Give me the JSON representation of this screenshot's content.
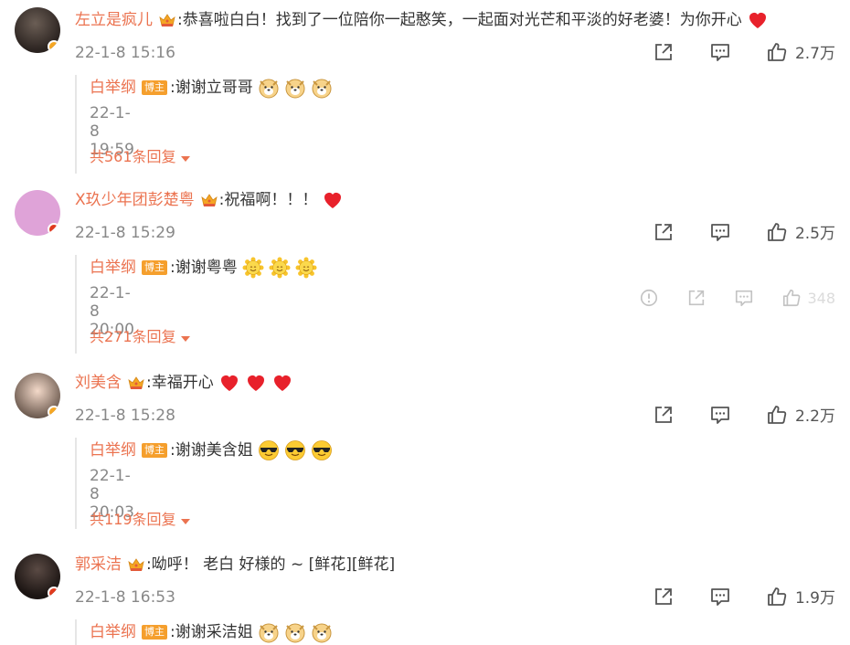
{
  "comments": [
    {
      "name": "左立是疯儿",
      "text": ":恭喜啦白白！找到了一位陪你一起憨笑，一起面对光芒和平淡的好老婆！为你开心",
      "time": "22-1-8 15:16",
      "likes": "2.7万",
      "reply": {
        "name": "白举纲",
        "badge": "博主",
        "text": ":谢谢立哥哥",
        "time": "22-1-8 19:59"
      },
      "more": "共561条回复"
    },
    {
      "name": "X玖少年团彭楚粤",
      "text": ":祝福啊！！！",
      "time": "22-1-8 15:29",
      "likes": "2.5万",
      "reply": {
        "name": "白举纲",
        "badge": "博主",
        "text": ":谢谢粤粤",
        "time": "22-1-8 20:00",
        "likes": "348"
      },
      "more": "共271条回复"
    },
    {
      "name": "刘美含",
      "text": ":幸福开心",
      "time": "22-1-8 15:28",
      "likes": "2.2万",
      "reply": {
        "name": "白举纲",
        "badge": "博主",
        "text": ":谢谢美含姐",
        "time": "22-1-8 20:03"
      },
      "more": "共119条回复"
    },
    {
      "name": "郭采洁",
      "text": ":呦呼！ 老白 好様的 ~ [鲜花][鲜花]",
      "time": "22-1-8 16:53",
      "likes": "1.9万",
      "reply": {
        "name": "白举纲",
        "badge": "博主",
        "text": ":谢谢采洁姐"
      }
    }
  ],
  "colors": {
    "name": "#eb7350",
    "badge": "#f59f2d",
    "verified": "#f5a623",
    "verified_red": "#e03a1e"
  },
  "icons": [
    "share-icon",
    "comment-icon",
    "like-icon",
    "report-icon",
    "crown-icon",
    "dog-emoji",
    "sun-emoji",
    "sunglasses-emoji",
    "heart-emoji"
  ]
}
